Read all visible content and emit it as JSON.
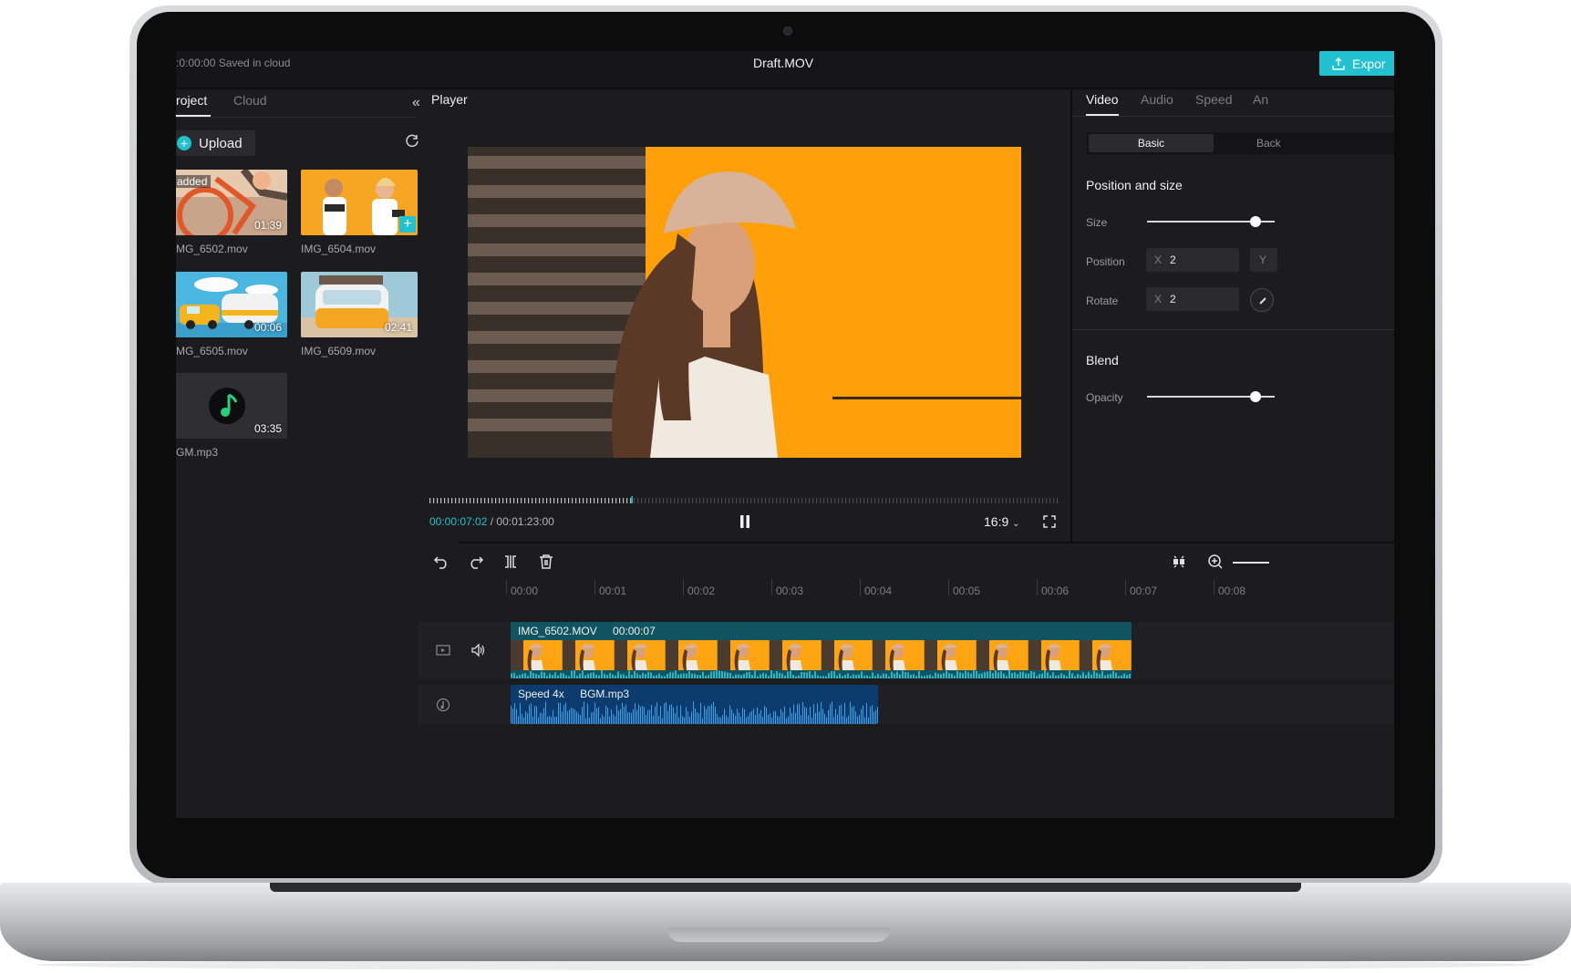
{
  "app": {
    "saved_status": ":0:00:00 Saved in cloud",
    "title": "Draft.MOV",
    "export_label": "Expor"
  },
  "left_panel": {
    "tabs": [
      {
        "label": "roject",
        "active": true
      },
      {
        "label": "Cloud",
        "active": false
      }
    ],
    "collapse_icon": "double-chevron-left-icon",
    "upload_label": "Upload",
    "refresh_icon": "refresh-icon",
    "media": [
      {
        "name": "IMG_6502.mov",
        "display_name": "MG_6502.mov",
        "duration": "01:39",
        "badge": "added",
        "thumb": "bicycle"
      },
      {
        "name": "IMG_6504.mov",
        "display_name": "IMG_6504.mov",
        "duration": "",
        "badge": "",
        "thumb": "couple",
        "add_button": "+"
      },
      {
        "name": "IMG_6505.mov",
        "display_name": "MG_6505.mov",
        "duration": "00:06",
        "badge": "",
        "thumb": "caravan"
      },
      {
        "name": "IMG_6509.mov",
        "display_name": "IMG_6509.mov",
        "duration": "02:41",
        "badge": "",
        "thumb": "van"
      },
      {
        "name": "BGM.mp3",
        "display_name": "GM.mp3",
        "duration": "03:35",
        "badge": "",
        "thumb": "music"
      }
    ]
  },
  "player": {
    "label": "Player",
    "current_time": "00:00:07:02",
    "total_time": " / 00:01:23:00",
    "aspect_ratio": "16:9",
    "progress": 0.32,
    "colors": {
      "accent": "#22c1cf",
      "video_bg": "#ff9f0a"
    }
  },
  "right_panel": {
    "tabs": [
      {
        "label": "Video",
        "active": true
      },
      {
        "label": "Audio",
        "active": false
      },
      {
        "label": "Speed",
        "active": false
      },
      {
        "label": "An",
        "active": false
      }
    ],
    "segments": {
      "basic": "Basic",
      "back": "Back"
    },
    "position_size": {
      "title": "Position and size",
      "size_label": "Size",
      "size_value": 0.85,
      "position_label": "Position",
      "position_x_axis": "X",
      "position_x": "2",
      "position_y_axis": "Y",
      "rotate_label": "Rotate",
      "rotate_x_axis": "X",
      "rotate_x": "2"
    },
    "blend": {
      "title": "Blend",
      "opacity_label": "Opacity",
      "opacity_value": 0.85
    }
  },
  "toolbar": {
    "tools": [
      "undo-icon",
      "redo-icon",
      "split-icon",
      "delete-icon"
    ],
    "right_tools": [
      "snap-icon",
      "zoom-in-icon"
    ]
  },
  "timeline": {
    "ruler": [
      "00:00",
      "00:01",
      "00:02",
      "00:03",
      "00:04",
      "00:05",
      "00:06",
      "00:07",
      "00:08"
    ],
    "video_clip": {
      "name": "IMG_6502.MOV",
      "duration": "00:00:07"
    },
    "audio_clip": {
      "speed": "Speed 4x",
      "name": "BGM.mp3"
    }
  }
}
